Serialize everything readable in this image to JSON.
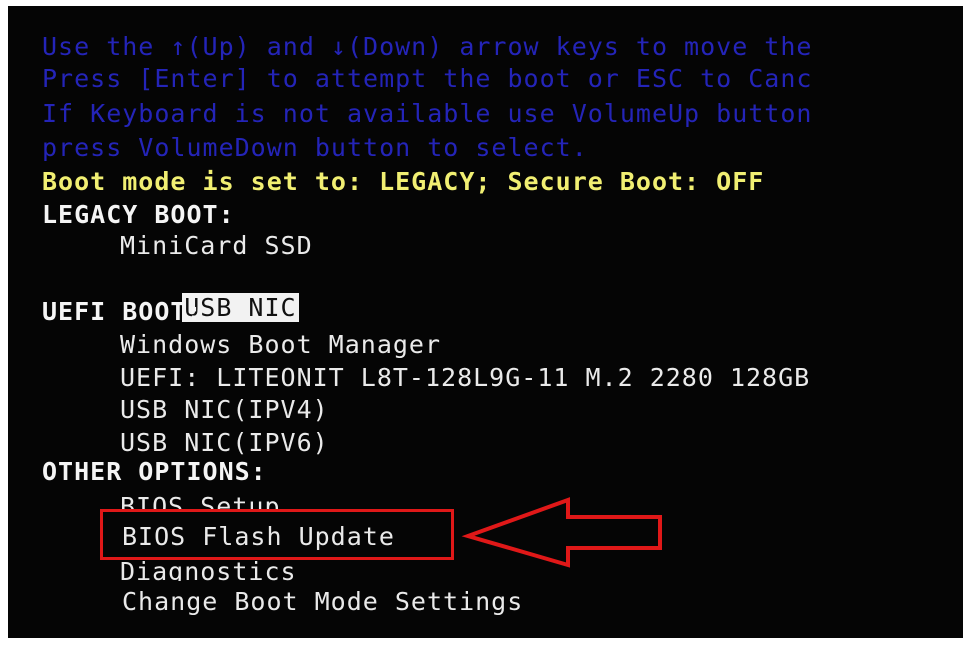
{
  "instructions": [
    "Use the ↑(Up) and ↓(Down) arrow keys to move the",
    "Press [Enter] to attempt the boot or ESC to Canc",
    "If Keyboard is not available use VolumeUp button",
    "press VolumeDown button to select."
  ],
  "boot_mode_status": "Boot mode is set to: LEGACY; Secure Boot: OFF",
  "legacy_boot": {
    "header": "LEGACY BOOT:",
    "items": [
      "MiniCard SSD",
      "USB NIC"
    ],
    "selected": "USB NIC"
  },
  "uefi_boot": {
    "header": "UEFI BOOT:",
    "items": [
      "Windows Boot Manager",
      "UEFI: LITEONIT L8T-128L9G-11 M.2 2280 128GB",
      "USB NIC(IPV4)",
      "USB NIC(IPV6)"
    ]
  },
  "other_options": {
    "header": "OTHER OPTIONS:",
    "items": [
      "BIOS Setup",
      "BIOS Flash Update",
      "Diagnostics",
      "Change Boot Mode Settings"
    ],
    "annotated": "BIOS Flash Update"
  },
  "colors": {
    "background": "#050505",
    "instruction_text": "#2a2ad8",
    "status_text": "#f1ef72",
    "menu_text": "#eaeaea",
    "annotation": "#e01818"
  },
  "icons": {
    "pointer": "red-outline-arrow-icon"
  }
}
